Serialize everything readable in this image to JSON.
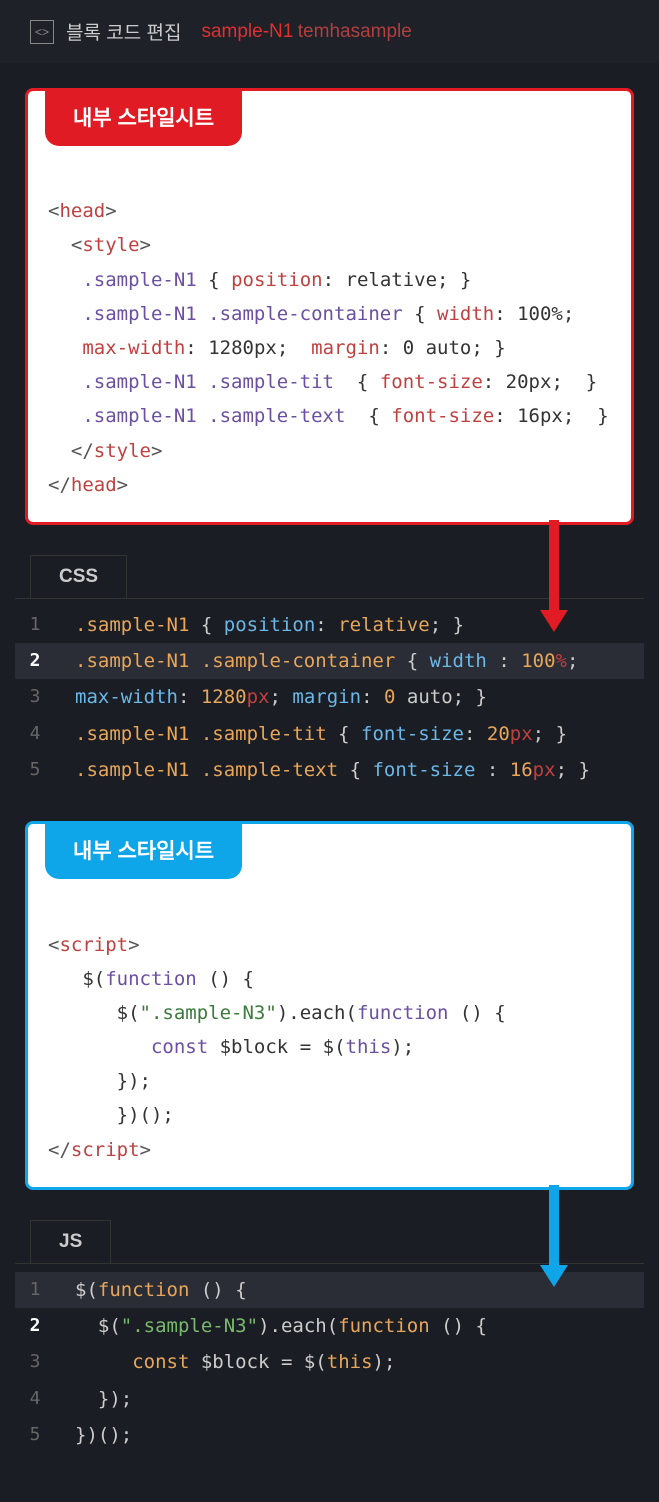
{
  "header": {
    "title": "블록 코드 편집",
    "sub1": "sample-N1",
    "sub2": "temhasample"
  },
  "cards": {
    "css": {
      "tab": "내부 스타일시트",
      "lines": {
        "head_open": "head",
        "style_open": "style",
        "sel1": ".sample-N1",
        "pos_prop": "position",
        "pos_val": "relative",
        "sel2a": ".sample-N1",
        "sel2b": ".sample-container",
        "width_prop": "width",
        "width_val": "100%",
        "mw_prop": "max-width",
        "mw_val": "1280px",
        "margin_prop": "margin",
        "margin_val": "0 auto",
        "sel3a": ".sample-N1",
        "sel3b": ".sample-tit",
        "fs_prop": "font-size",
        "fs_val1": "20px",
        "sel4a": ".sample-N1",
        "sel4b": ".sample-text",
        "fs_val2": "16px",
        "style_close": "style",
        "head_close": "head"
      }
    },
    "js": {
      "tab": "내부 스타일시트",
      "lines": {
        "script_open": "script",
        "jq": "$",
        "func": "function",
        "sel": "\".sample-N3\"",
        "each": ".each",
        "const": "const",
        "block": "$block",
        "eq": "=",
        "this": "this",
        "script_close": "script"
      }
    }
  },
  "editors": {
    "css": {
      "tab": "CSS",
      "lines": [
        {
          "n": "1",
          "active": false,
          "hl": false
        },
        {
          "n": "2",
          "active": true,
          "hl": true
        },
        {
          "n": "3",
          "active": false,
          "hl": false
        },
        {
          "n": "4",
          "active": false,
          "hl": false
        },
        {
          "n": "5",
          "active": false,
          "hl": false
        }
      ],
      "code": {
        "sel1": ".sample-N1",
        "pos_prop": "position",
        "pos_val": "relative",
        "sel2": ".sample-N1 .sample-container",
        "width_prop": "width",
        "width_val": "100",
        "mw_prop": "max-width",
        "mw_num": "1280",
        "mw_unit": "px",
        "margin_prop": "margin",
        "margin_num": "0",
        "margin_val": "auto",
        "sel3": ".sample-N1 .sample-tit",
        "fs_prop": "font-size",
        "fs_num1": "20",
        "fs_unit": "px",
        "sel4": ".sample-N1 .sample-text",
        "fs_num2": "16"
      }
    },
    "js": {
      "tab": "JS",
      "lines": [
        {
          "n": "1",
          "active": false,
          "hl": true
        },
        {
          "n": "2",
          "active": true,
          "hl": false
        },
        {
          "n": "3",
          "active": false,
          "hl": false
        },
        {
          "n": "4",
          "active": false,
          "hl": false
        },
        {
          "n": "5",
          "active": false,
          "hl": false
        }
      ],
      "code": {
        "func": "function",
        "sel": "\".sample-N3\"",
        "each": ".each",
        "const": "const",
        "block": "$block",
        "this": "this"
      }
    }
  }
}
